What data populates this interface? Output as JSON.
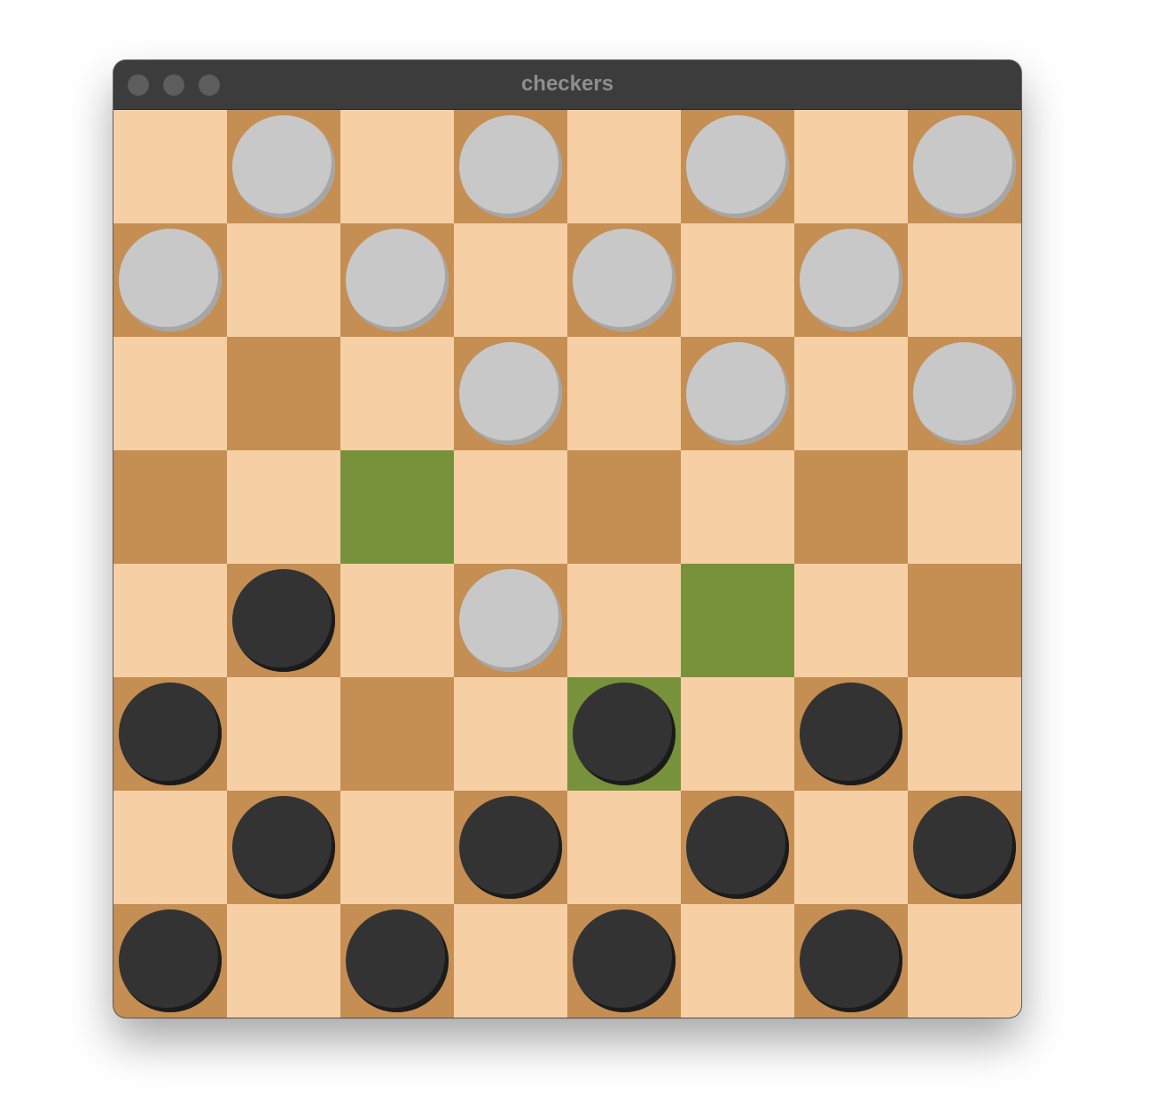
{
  "window": {
    "title": "checkers"
  },
  "colors": {
    "light_square": "#f6cfa5",
    "dark_square": "#c58e53",
    "highlight_square": "#77923b",
    "light_piece": "#c8c8c8",
    "dark_piece": "#333333"
  },
  "board": {
    "rows": 8,
    "cols": 8,
    "pieces": [
      [
        "",
        "light",
        "",
        "light",
        "",
        "light",
        "",
        "light"
      ],
      [
        "light",
        "",
        "light",
        "",
        "light",
        "",
        "light",
        ""
      ],
      [
        "",
        "",
        "",
        "light",
        "",
        "light",
        "",
        "light"
      ],
      [
        "",
        "",
        "",
        "",
        "",
        "",
        "",
        ""
      ],
      [
        "",
        "dark",
        "",
        "light",
        "",
        "",
        "",
        ""
      ],
      [
        "dark",
        "",
        "",
        "",
        "dark",
        "",
        "dark",
        ""
      ],
      [
        "",
        "dark",
        "",
        "dark",
        "",
        "dark",
        "",
        "dark"
      ],
      [
        "dark",
        "",
        "dark",
        "",
        "dark",
        "",
        "dark",
        ""
      ]
    ],
    "highlighted_squares": [
      [
        3,
        2
      ],
      [
        4,
        5
      ],
      [
        5,
        4
      ]
    ]
  }
}
